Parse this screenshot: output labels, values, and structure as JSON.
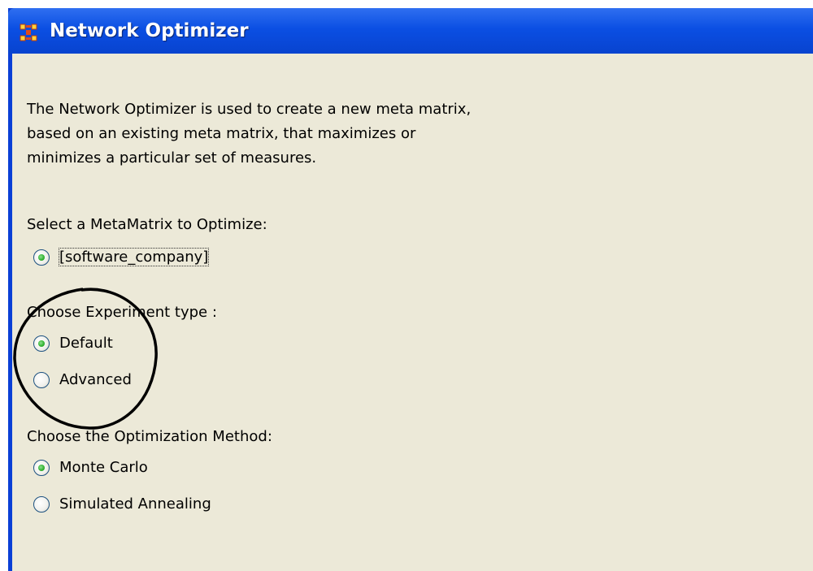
{
  "window": {
    "title": "Network Optimizer",
    "icon": "network-grid-icon"
  },
  "description": {
    "line1": "The Network Optimizer is used to create a new meta matrix,",
    "line2": "based on an existing meta matrix, that maximizes or",
    "line3": "minimizes a particular set of measures."
  },
  "metamatrix": {
    "label": "Select a MetaMatrix to Optimize:",
    "options": [
      {
        "label": "[software_company]",
        "selected": true
      }
    ]
  },
  "experiment": {
    "label": "Choose Experiment type :",
    "options": [
      {
        "label": "Default",
        "selected": true
      },
      {
        "label": "Advanced",
        "selected": false
      }
    ]
  },
  "method": {
    "label": "Choose the Optimization Method:",
    "options": [
      {
        "label": "Monte Carlo",
        "selected": true
      },
      {
        "label": "Simulated Annealing",
        "selected": false
      }
    ]
  },
  "colors": {
    "titlebar": "#0b4fe3",
    "client_bg": "#ece9d8",
    "radio_selected": "#35b535"
  }
}
